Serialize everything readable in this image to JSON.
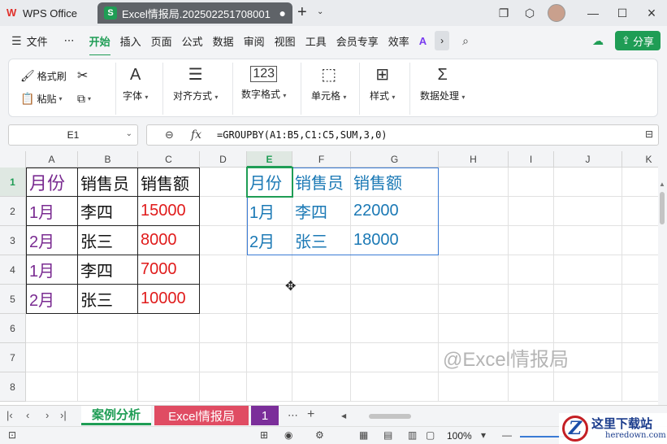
{
  "titlebar": {
    "home_tab": "WPS Office",
    "doc_badge": "S",
    "doc_tab": "Excel情报局.202502251708001",
    "doc_dot": "●",
    "add_tab": "+",
    "more_tabs": "⌄"
  },
  "menubar": {
    "file": "文件",
    "more": "⋯",
    "items": [
      "开始",
      "插入",
      "页面",
      "公式",
      "数据",
      "审阅",
      "视图",
      "工具",
      "会员专享",
      "效率"
    ],
    "share": "分享"
  },
  "ribbon": {
    "format_painter": "格式刷",
    "paste": "粘贴",
    "font": "字体",
    "alignment": "对齐方式",
    "number_format": "数字格式",
    "cells": "单元格",
    "styles": "样式",
    "data_processing": "数据处理"
  },
  "formula_bar": {
    "name_box": "E1",
    "fx": "fx",
    "formula": "=GROUPBY(A1:B5,C1:C5,SUM,3,0)"
  },
  "grid": {
    "columns": [
      "A",
      "B",
      "C",
      "D",
      "E",
      "F",
      "G",
      "H",
      "I",
      "J",
      "K"
    ],
    "rows": [
      "1",
      "2",
      "3",
      "4",
      "5",
      "6",
      "7",
      "8"
    ],
    "source_table": [
      [
        "月份",
        "销售员",
        "销售额"
      ],
      [
        "1月",
        "李四",
        "15000"
      ],
      [
        "2月",
        "张三",
        "8000"
      ],
      [
        "1月",
        "李四",
        "7000"
      ],
      [
        "2月",
        "张三",
        "10000"
      ]
    ],
    "result_table": [
      [
        "月份",
        "销售员",
        "销售额"
      ],
      [
        "1月",
        "李四",
        "22000"
      ],
      [
        "2月",
        "张三",
        "18000"
      ]
    ],
    "watermark": "@Excel情报局"
  },
  "sheets": {
    "active": "案例分析",
    "second": "Excel情报局",
    "third": "1",
    "more": "⋯",
    "add": "+"
  },
  "status": {
    "zoom": "100%"
  },
  "site_badge": {
    "name": "这里下载站",
    "url": "heredown.com"
  },
  "colors": {
    "accent": "#1f9d55",
    "month_text": "#7a2b91",
    "amount_text": "#e01b1b",
    "result_text": "#1b79b5"
  }
}
